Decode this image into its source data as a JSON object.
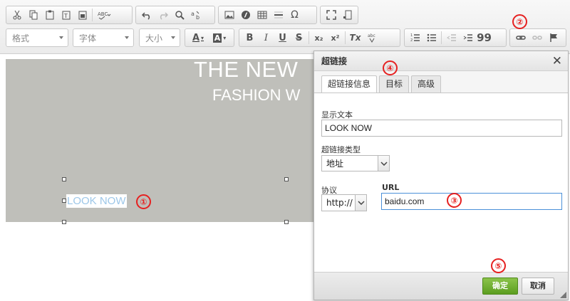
{
  "toolbar": {
    "format_label": "格式",
    "font_label": "字体",
    "size_label": "大小",
    "text_color_label": "A",
    "bg_color_label": "A",
    "bold_label": "B",
    "italic_label": "I",
    "underline_label": "U",
    "strike_label": "S",
    "subscript_label": "x₂",
    "superscript_label": "x²",
    "remove_format_label": "Tx",
    "quote_label": "99"
  },
  "editor": {
    "banner_title": "THE NEW",
    "banner_subtitle": "FASHION W",
    "link_text": "LOOK NOW"
  },
  "markers": [
    "①",
    "②",
    "③",
    "④",
    "⑤"
  ],
  "dialog": {
    "title": "超链接",
    "close_label": "✕",
    "tabs": [
      {
        "label": "超链接信息"
      },
      {
        "label": "目标"
      },
      {
        "label": "高级"
      }
    ],
    "display_text_label": "显示文本",
    "display_text_value": "LOOK NOW",
    "link_type_label": "超链接类型",
    "link_type_value": "地址",
    "protocol_label": "协议",
    "protocol_value": "http://",
    "url_label": "URL",
    "url_value": "baidu.com",
    "ok_label": "确定",
    "cancel_label": "取消"
  },
  "colors": {
    "accent_green": "#6aab2a",
    "marker_red": "#e62020",
    "link_blue": "#9dc7e8",
    "focus_blue": "#4a90d9"
  }
}
